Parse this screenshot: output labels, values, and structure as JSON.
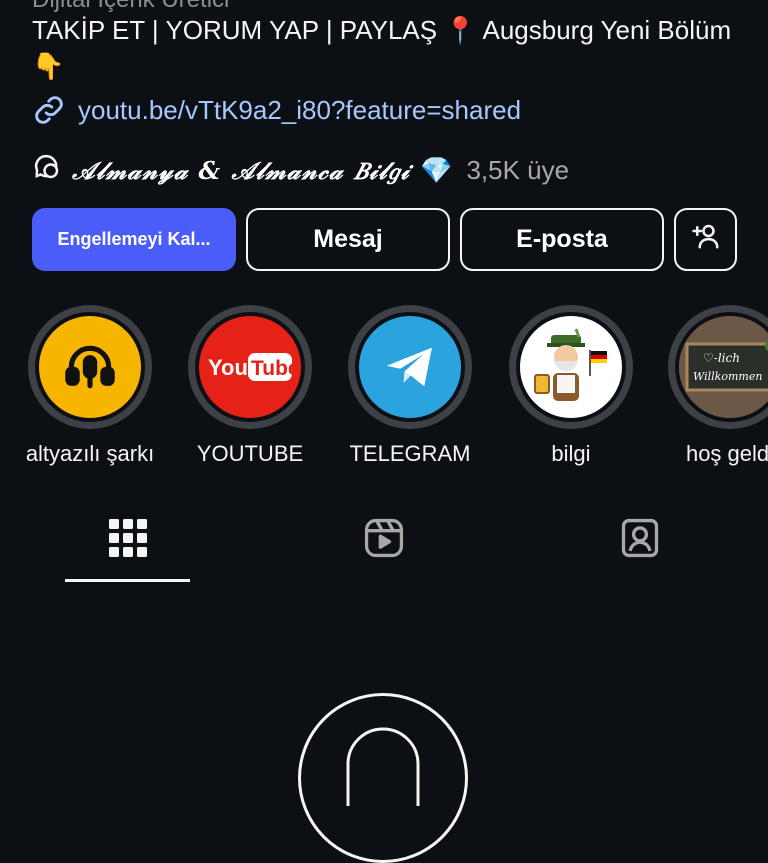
{
  "profile": {
    "category": "Dijital İçerik Üretici",
    "bio": "TAKİP ET | YORUM YAP | PAYLAŞ 📍 Augsburg Yeni Bölüm 👇",
    "link": "youtu.be/vTtK9a2_i80?feature=shared",
    "channel": {
      "name": "𝒜𝓁𝓂𝒶𝓃𝓎𝒶 & 𝒜𝓁𝓂𝒶𝓃𝒸𝒶 𝐵𝒾𝓁𝑔𝒾",
      "badge": "💎",
      "members": "3,5K üye"
    }
  },
  "actions": {
    "unblock_label": "Engellemeyi Kal...",
    "message_label": "Mesaj",
    "email_label": "E-posta",
    "add_person_icon": "add-person-icon"
  },
  "highlights": [
    {
      "label": "altyazılı şarkı",
      "icon": "headphones-microphone-icon",
      "color": "#f7b500"
    },
    {
      "label": "YOUTUBE",
      "icon": "youtube-logo",
      "color": "#e62117"
    },
    {
      "label": "TELEGRAM",
      "icon": "telegram-logo",
      "color": "#2aa3df"
    },
    {
      "label": "bilgi",
      "icon": "bavarian-character-illustration",
      "color": "#ffffff"
    },
    {
      "label": "hoş geldi",
      "logo_text": "-lich Willkommen",
      "icon": "chalkboard-welcome-sign",
      "color": "#2b2f2a"
    }
  ],
  "tabs": [
    {
      "name": "grid",
      "icon": "grid-icon",
      "selected": true
    },
    {
      "name": "reels",
      "icon": "reels-icon",
      "selected": false
    },
    {
      "name": "tagged",
      "icon": "tagged-person-icon",
      "selected": false
    }
  ],
  "colors": {
    "background": "#0c1014",
    "primary_button": "#4a5df9",
    "link": "#a6c8ff",
    "muted_text": "#a8a8a8"
  }
}
